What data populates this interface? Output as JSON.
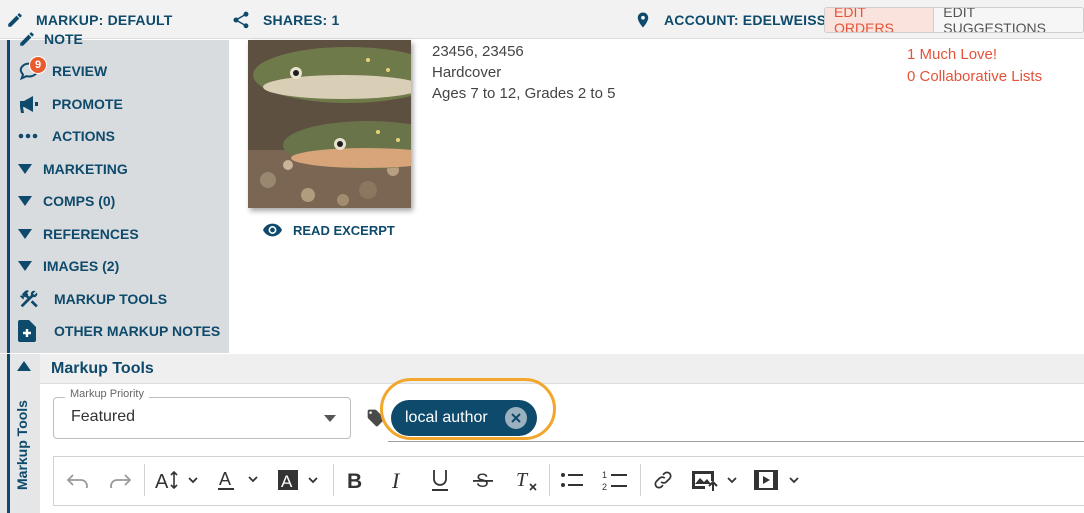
{
  "topbar": {
    "markup_label": "MARKUP: DEFAULT",
    "shares_label": "SHARES: 1",
    "account_label": "ACCOUNT: EDELWEISS",
    "edit_orders_label": "EDIT ORDERS",
    "edit_suggestions_label": "EDIT SUGGESTIONS"
  },
  "sidebar": {
    "items": [
      {
        "label": "NOTE",
        "icon": "pencil-icon"
      },
      {
        "label": "REVIEW",
        "icon": "chat-icon",
        "badge": "9"
      },
      {
        "label": "PROMOTE",
        "icon": "megaphone-icon"
      },
      {
        "label": "ACTIONS",
        "icon": "ellipsis-icon"
      },
      {
        "label": "MARKETING",
        "icon": "triangle-down-icon"
      },
      {
        "label": "COMPS (0)",
        "icon": "triangle-down-icon"
      },
      {
        "label": "REFERENCES",
        "icon": "triangle-down-icon"
      },
      {
        "label": "IMAGES (2)",
        "icon": "triangle-down-icon"
      },
      {
        "label": "MARKUP TOOLS",
        "icon": "tools-icon"
      },
      {
        "label": "OTHER MARKUP NOTES",
        "icon": "note-add-icon"
      }
    ]
  },
  "book": {
    "read_excerpt_label": "READ EXCERPT",
    "meta": [
      "23456, 23456",
      "Hardcover",
      "Ages 7 to 12, Grades 2 to 5"
    ],
    "links": [
      "1 Much Love!",
      "0 Collaborative Lists"
    ]
  },
  "markup_tools": {
    "vertical_tab_label": "Markup Tools",
    "panel_title": "Markup Tools",
    "priority_legend": "Markup Priority",
    "priority_value": "Featured",
    "tag_chip_label": "local author"
  },
  "colors": {
    "navy": "#0e4a6b",
    "accent_red": "#e4533a",
    "highlight_orange": "#f2a72c",
    "sidebar_gray": "#d9dcde"
  }
}
